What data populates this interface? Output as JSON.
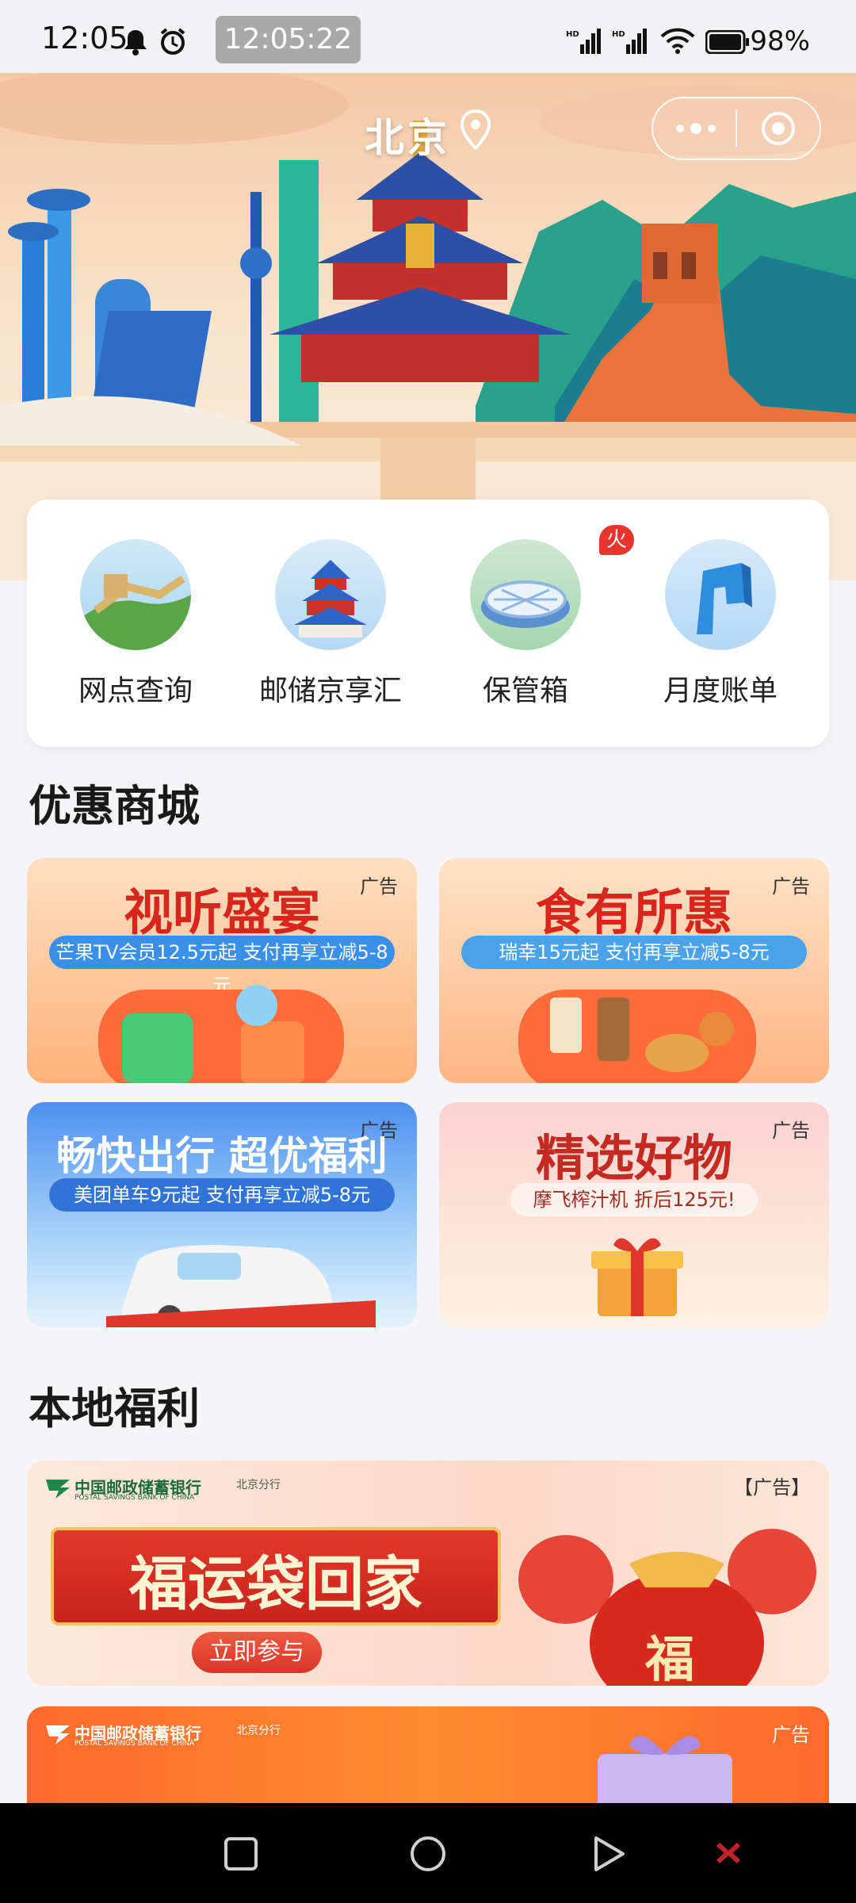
{
  "status_bar": {
    "time": "12:05",
    "clock_badge": "12:05:22",
    "battery": "98%"
  },
  "header": {
    "city": "北京"
  },
  "quick_actions": [
    {
      "label": "网点查询",
      "icon": "great-wall-icon"
    },
    {
      "label": "邮储京享汇",
      "icon": "temple-of-heaven-icon"
    },
    {
      "label": "保管箱",
      "icon": "birds-nest-stadium-icon",
      "badge": "火"
    },
    {
      "label": "月度账单",
      "icon": "cctv-tower-icon"
    }
  ],
  "sections": {
    "mall_title": "优惠商城",
    "local_title": "本地福利"
  },
  "mall_cards": [
    {
      "title": "视听盛宴",
      "subtitle": "芒果TV会员12.5元起 支付再享立减5-8元",
      "ad": "广告"
    },
    {
      "title": "食有所惠",
      "subtitle": "瑞幸15元起 支付再享立减5-8元",
      "ad": "广告"
    },
    {
      "title": "畅快出行 超优福利",
      "subtitle": "美团单车9元起 支付再享立减5-8元",
      "ad": "广告"
    },
    {
      "title": "精选好物",
      "subtitle": "摩飞榨汁机 折后125元!",
      "ad": "广告"
    }
  ],
  "local_banners": [
    {
      "bank": "中国邮政储蓄银行",
      "bank_en": "POSTAL SAVINGS BANK OF CHINA",
      "branch": "北京分行",
      "title": "福运袋回家",
      "cta": "立即参与",
      "ad": "【广告】",
      "fu": "福"
    },
    {
      "bank": "中国邮政储蓄银行",
      "bank_en": "POSTAL SAVINGS BANK OF CHINA",
      "branch": "北京分行",
      "ad": "广告"
    }
  ],
  "colors": {
    "accent_red": "#e23b2c",
    "card_orange": "#ffb37a",
    "card_blue": "#4b8ef0",
    "card_pink": "#fbd7cf"
  }
}
